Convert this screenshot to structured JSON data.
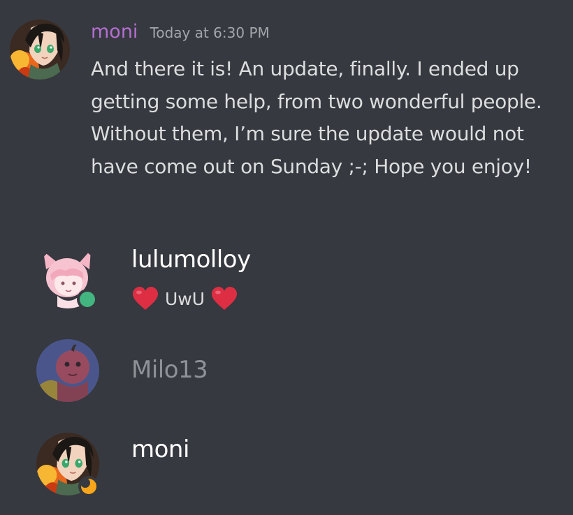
{
  "message": {
    "author": "moni",
    "timestamp": "Today at 6:30 PM",
    "text": "And there it is! An update, finally. I ended up getting some help, from two wonderful people. Without them, I’m sure the update would not have come out on Sunday ;-; Hope you enjoy!",
    "author_color": "#b56fd2"
  },
  "members": [
    {
      "name": "lulumolloy",
      "status_text": "UwU",
      "status_emoji": "heart-icon",
      "presence": "online",
      "presence_color": "#43b581"
    },
    {
      "name": "Milo13",
      "presence": "offline"
    },
    {
      "name": "moni",
      "presence": "idle",
      "presence_color": "#faa61a"
    }
  ],
  "colors": {
    "background": "#36393f",
    "text": "#dcddde",
    "muted": "#8e9297"
  }
}
